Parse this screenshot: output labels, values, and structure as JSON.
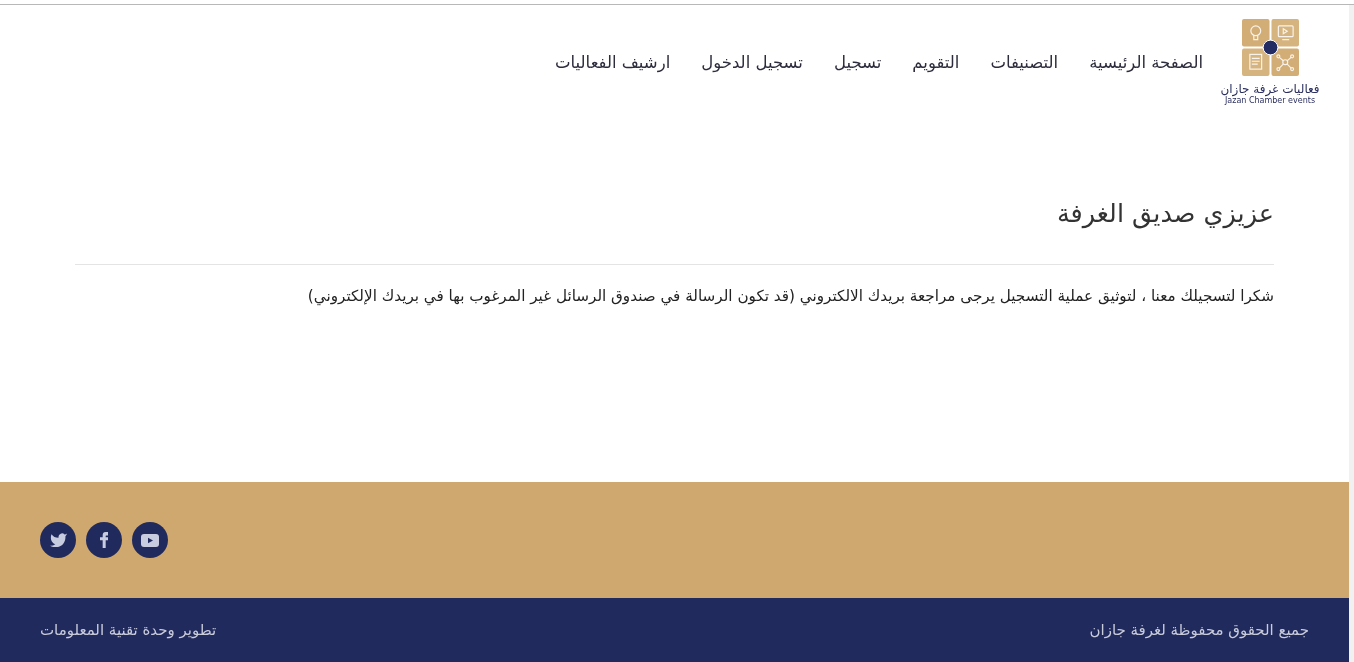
{
  "header": {
    "logo": {
      "title": "فعاليات غرفة جازان",
      "subtitle": "Jazan Chamber events"
    },
    "nav": [
      {
        "label": "الصفحة الرئيسية"
      },
      {
        "label": "التصنيفات"
      },
      {
        "label": "التقويم"
      },
      {
        "label": "تسجيل"
      },
      {
        "label": "تسجيل الدخول"
      },
      {
        "label": "ارشيف الفعاليات"
      }
    ]
  },
  "content": {
    "heading": "عزيزي صديق الغرفة",
    "message": "شكرا لتسجيلك معنا ، لتوثيق عملية التسجيل يرجى مراجعة بريدك الالكتروني (قد تكون الرسالة في صندوق الرسائل غير المرغوب بها في بريدك الإلكتروني)"
  },
  "footer": {
    "social": [
      {
        "kind": "twitter"
      },
      {
        "kind": "facebook"
      },
      {
        "kind": "youtube"
      }
    ],
    "copyright": "جميع الحقوق محفوظة لغرفة جازان",
    "credit": "تطوير وحدة تقنية المعلومات"
  }
}
